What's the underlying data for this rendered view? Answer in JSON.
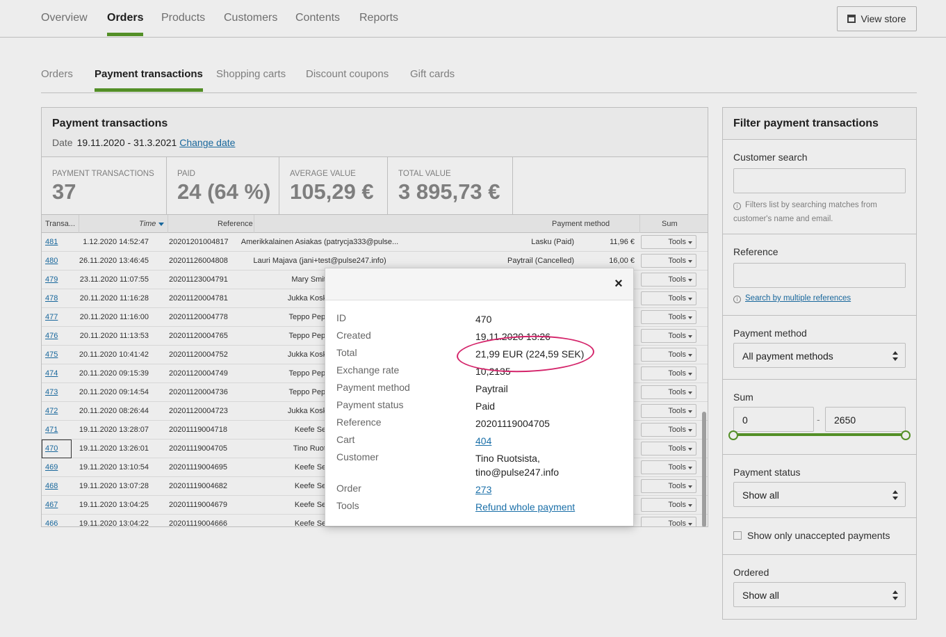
{
  "topnav": {
    "tabs": [
      "Overview",
      "Orders",
      "Products",
      "Customers",
      "Contents",
      "Reports"
    ],
    "active_tab": "Orders",
    "view_store_label": "View store"
  },
  "subnav": {
    "tabs": [
      "Orders",
      "Payment transactions",
      "Shopping carts",
      "Discount coupons",
      "Gift cards"
    ],
    "active_tab": "Payment transactions"
  },
  "panel": {
    "title": "Payment transactions",
    "date_label": "Date",
    "date_value": "19.11.2020 - 31.3.2021",
    "change_date_label": "Change date",
    "stats": [
      {
        "label": "Payment transactions",
        "value": "37"
      },
      {
        "label": "Paid",
        "value": "24 (64 %)"
      },
      {
        "label": "Average value",
        "value": "105,29 €"
      },
      {
        "label": "Total value",
        "value": "3 895,73 €"
      }
    ],
    "columns": {
      "transaction": "Transa...",
      "time": "Time",
      "reference": "Reference",
      "payment_method": "Payment method",
      "sum": "Sum"
    },
    "rows": [
      {
        "id": "481",
        "time": "1.12.2020 14:52:47",
        "reference": "20201201004817",
        "customer": "Amerikkalainen Asiakas (patrycja333@pulse...",
        "payment_method": "Lasku (Paid)",
        "sum": "11,96 €",
        "tools": "Tools"
      },
      {
        "id": "480",
        "time": "26.11.2020 13:46:45",
        "reference": "20201126004808",
        "customer": "Lauri Majava (jani+test@pulse247.info)",
        "payment_method": "Paytrail (Cancelled)",
        "sum": "16,00 €",
        "tools": "Tools"
      },
      {
        "id": "479",
        "time": "23.11.2020 11:07:55",
        "reference": "20201123004791",
        "customer": "Mary Smith (patr",
        "payment_method": "",
        "sum": "",
        "tools": "Tools"
      },
      {
        "id": "478",
        "time": "20.11.2020 11:16:28",
        "reference": "20201120004781",
        "customer": "Jukka Koskinen (ju",
        "payment_method": "",
        "sum": "",
        "tools": "Tools"
      },
      {
        "id": "477",
        "time": "20.11.2020 11:16:00",
        "reference": "20201120004778",
        "customer": "Teppo Pepe (jani+",
        "payment_method": "",
        "sum": "",
        "tools": "Tools"
      },
      {
        "id": "476",
        "time": "20.11.2020 11:13:53",
        "reference": "20201120004765",
        "customer": "Teppo Pepe (jani+",
        "payment_method": "",
        "sum": "",
        "tools": "Tools"
      },
      {
        "id": "475",
        "time": "20.11.2020 10:41:42",
        "reference": "20201120004752",
        "customer": "Jukka Koskinen (ju",
        "payment_method": "",
        "sum": "",
        "tools": "Tools"
      },
      {
        "id": "474",
        "time": "20.11.2020 09:15:39",
        "reference": "20201120004749",
        "customer": "Teppo Pepe (jani+",
        "payment_method": "",
        "sum": "",
        "tools": "Tools"
      },
      {
        "id": "473",
        "time": "20.11.2020 09:14:54",
        "reference": "20201120004736",
        "customer": "Teppo Pepe (jani+",
        "payment_method": "",
        "sum": "",
        "tools": "Tools"
      },
      {
        "id": "472",
        "time": "20.11.2020 08:26:44",
        "reference": "20201120004723",
        "customer": "Jukka Koskinen (ju",
        "payment_method": "",
        "sum": "",
        "tools": "Tools"
      },
      {
        "id": "471",
        "time": "19.11.2020 13:28:07",
        "reference": "20201119004718",
        "customer": "Keefe Sellers (",
        "payment_method": "",
        "sum": "",
        "tools": "Tools"
      },
      {
        "id": "470",
        "time": "19.11.2020 13:26:01",
        "reference": "20201119004705",
        "customer": "Tino Ruotsista (",
        "payment_method": "",
        "sum": "",
        "tools": "Tools",
        "selected": true
      },
      {
        "id": "469",
        "time": "19.11.2020 13:10:54",
        "reference": "20201119004695",
        "customer": "Keefe Sellers (",
        "payment_method": "",
        "sum": "",
        "tools": "Tools"
      },
      {
        "id": "468",
        "time": "19.11.2020 13:07:28",
        "reference": "20201119004682",
        "customer": "Keefe Sellers (",
        "payment_method": "",
        "sum": "",
        "tools": "Tools"
      },
      {
        "id": "467",
        "time": "19.11.2020 13:04:25",
        "reference": "20201119004679",
        "customer": "Keefe Sellers (",
        "payment_method": "",
        "sum": "",
        "tools": "Tools"
      },
      {
        "id": "466",
        "time": "19.11.2020 13:04:22",
        "reference": "20201119004666",
        "customer": "Keefe Sellers (",
        "payment_method": "",
        "sum": "",
        "tools": "Tools"
      }
    ]
  },
  "filter": {
    "title": "Filter payment transactions",
    "customer_search_label": "Customer search",
    "customer_search_hint": "Filters list by searching matches from customer's name and email.",
    "reference_label": "Reference",
    "reference_link": "Search by multiple references",
    "payment_method_label": "Payment method",
    "payment_method_value": "All payment methods",
    "sum_label": "Sum",
    "sum_min": "0",
    "sum_max": "2650",
    "sum_separator": "-",
    "payment_status_label": "Payment status",
    "payment_status_value": "Show all",
    "unaccepted_label": "Show only unaccepted payments",
    "ordered_label": "Ordered",
    "ordered_value": "Show all"
  },
  "modal": {
    "close_label": "×",
    "fields": [
      {
        "key": "ID",
        "value": "470"
      },
      {
        "key": "Created",
        "value": "19.11.2020 13:26"
      },
      {
        "key": "Total",
        "value": "21,99 EUR (224,59 SEK)"
      },
      {
        "key": "Exchange rate",
        "value": "10,2135"
      },
      {
        "key": "Payment method",
        "value": "Paytrail"
      },
      {
        "key": "Payment status",
        "value": "Paid"
      },
      {
        "key": "Reference",
        "value": "20201119004705"
      },
      {
        "key": "Cart",
        "value": "404",
        "link": true
      },
      {
        "key": "Customer",
        "value": "Tino Ruotsista,",
        "value2": "tino@pulse247.info"
      },
      {
        "key": "Order",
        "value": "273",
        "link": true
      },
      {
        "key": "Tools",
        "value": "Refund whole payment",
        "link": true
      }
    ],
    "highlight_color": "#d4246a"
  },
  "colors": {
    "accent": "#5a9a2a",
    "link": "#1a6fa8"
  }
}
